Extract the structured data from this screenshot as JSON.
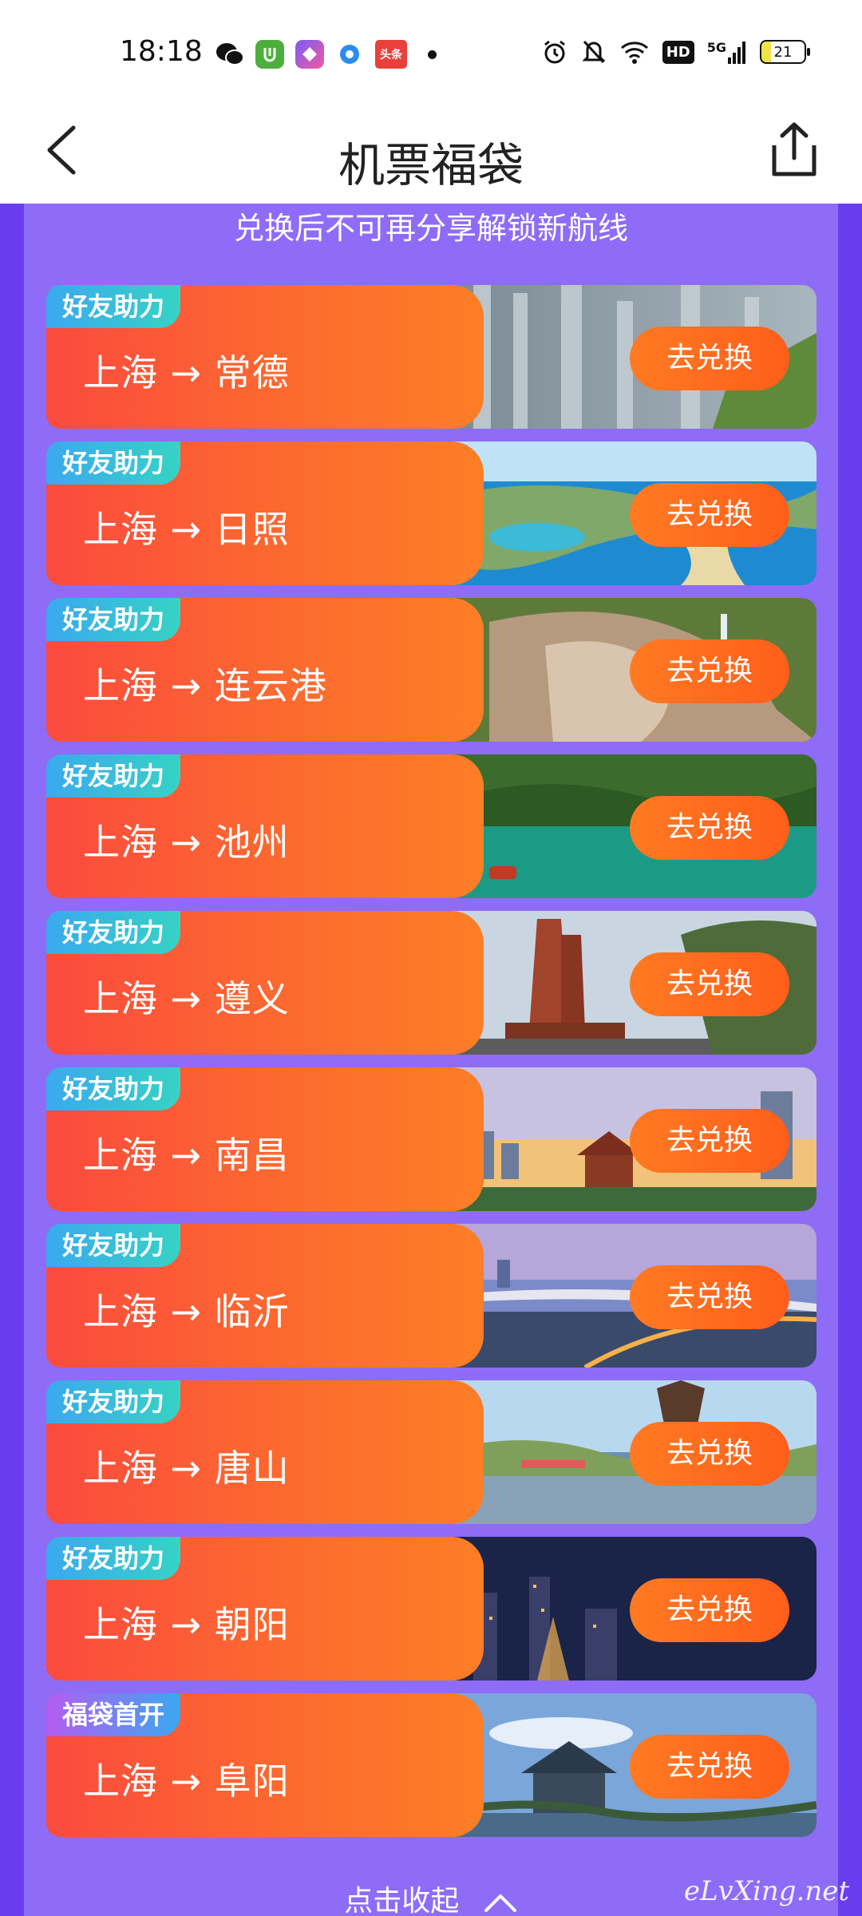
{
  "status_bar": {
    "time": "18:18",
    "battery": "21",
    "signal": "5G",
    "hd": "HD",
    "app_icons": [
      "wechat-icon",
      "app-green-icon",
      "app-colorful-icon",
      "app-blue-ring-icon",
      "toutiao-icon"
    ],
    "toutiao_label": "头条"
  },
  "nav": {
    "title": "机票福袋"
  },
  "subtitle": "兑换后不可再分享解锁新航线",
  "routes": [
    {
      "tag": "好友助力",
      "route": "上海 → 常德",
      "button": "去兑换",
      "scene": "cliffs"
    },
    {
      "tag": "好友助力",
      "route": "上海 → 日照",
      "button": "去兑换",
      "scene": "coast"
    },
    {
      "tag": "好友助力",
      "route": "上海 → 连云港",
      "button": "去兑换",
      "scene": "rocks"
    },
    {
      "tag": "好友助力",
      "route": "上海 → 池州",
      "button": "去兑换",
      "scene": "lake"
    },
    {
      "tag": "好友助力",
      "route": "上海 → 遵义",
      "button": "去兑换",
      "scene": "monument"
    },
    {
      "tag": "好友助力",
      "route": "上海 → 南昌",
      "button": "去兑换",
      "scene": "skyline"
    },
    {
      "tag": "好友助力",
      "route": "上海 → 临沂",
      "button": "去兑换",
      "scene": "bridge"
    },
    {
      "tag": "好友助力",
      "route": "上海 → 唐山",
      "button": "去兑换",
      "scene": "park"
    },
    {
      "tag": "好友助力",
      "route": "上海 → 朝阳",
      "button": "去兑换",
      "scene": "night"
    },
    {
      "tag": "福袋首开",
      "route": "上海 → 阜阳",
      "button": "去兑换",
      "scene": "pavilion"
    }
  ],
  "collapse_label": "点击收起",
  "watermark": "eLvXing.net",
  "colors": {
    "background": "#6a3cf0",
    "panel": "#8e6cf7",
    "card_left": "#fc6a2f",
    "button": "#ff6a1e",
    "tag": "#36b8e0"
  }
}
